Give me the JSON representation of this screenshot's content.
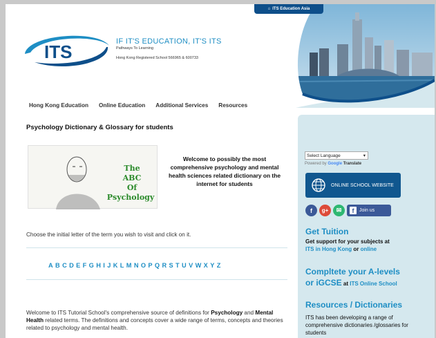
{
  "header": {
    "logo_text": "ITS",
    "tagline": "IF IT'S EDUCATION, IT'S ITS",
    "pathways": "Pathways To Learning",
    "registered": "Hong Kong Registered School 566965 & 600733",
    "asia_tab": "ITS Education Asia"
  },
  "nav": {
    "items": [
      "Hong Kong Education",
      "Online Education",
      "Additional Services",
      "Resources"
    ]
  },
  "main": {
    "title": "Psychology Dictionary & Glossary for students",
    "image_words": [
      "The",
      "ABC",
      "Of",
      "Psychology"
    ],
    "welcome": "Welcome to possibly the most comprehensive psychology and mental health sciences related dictionary on the internet for students",
    "choose": "Choose the initial letter of the term you wish to visit and click on it.",
    "letters": [
      "A",
      "B",
      "C",
      "D",
      "E",
      "F",
      "G",
      "H",
      "I",
      "J",
      "K",
      "L",
      "M",
      "N",
      "O",
      "P",
      "Q",
      "R",
      "S",
      "T",
      "U",
      "V",
      "W",
      "X",
      "Y",
      "Z"
    ],
    "intro_1": "Welcome to ITS Tutorial School's comprehensive source of definitions for",
    "intro_b1": "Psychology",
    "intro_and": " and ",
    "intro_b2": "Mental Health",
    "intro_2": " related terms. The definitions and concepts cover a wide range of terms, concepts and theories related to psychology and mental health."
  },
  "sidebar": {
    "language_select": "Select Language",
    "powered_by": "Powered by",
    "google": "Google",
    "translate": "Translate",
    "online_button": "ONLINE SCHOOL WEBSITE",
    "join_us": "Join us",
    "get_tuition_title": "Get Tuition",
    "get_tuition_text": "Get support for your subjects at",
    "its_hk": "ITS in Hong Kong",
    "or": " or ",
    "online": "online",
    "alevels_title_1": "Compltete your A-levels",
    "alevels_title_2": "or iGCSE",
    "alevels_at": " at ",
    "its_online": "ITS Online School",
    "resources_title": "Resources / Dictionaries",
    "resources_text": "ITS has been developing a range of comprehensive dictionaries /glossaries for students"
  },
  "colors": {
    "accent": "#1e8ec4",
    "navy": "#10578f",
    "sidebar_bg": "#d5e8ee"
  }
}
